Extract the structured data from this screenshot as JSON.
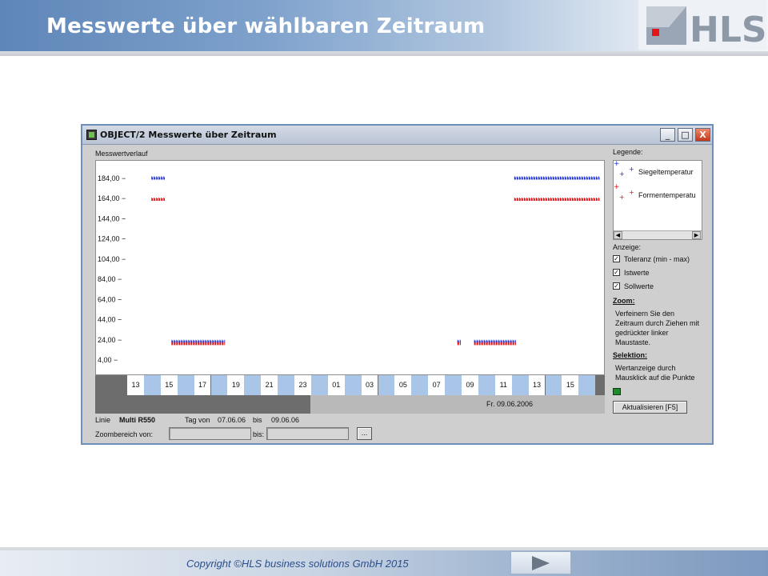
{
  "slide": {
    "title": "Messwerte über wählbaren Zeitraum",
    "logo_text": "HLS",
    "copyright": "Copyright ©HLS business solutions GmbH 2015"
  },
  "window": {
    "title": "OBJECT/2 Messwerte über Zeitraum",
    "buttons": [
      "_",
      "□",
      "X"
    ]
  },
  "plot": {
    "label": "Messwertverlauf",
    "y_ticks": [
      "184,00",
      "164,00",
      "144,00",
      "124,00",
      "104,00",
      "84,00",
      "64,00",
      "44,00",
      "24,00",
      "4,00"
    ],
    "timeline_ticks": [
      "13",
      "15",
      "17",
      "19",
      "21",
      "23",
      "01",
      "03",
      "05",
      "07",
      "09",
      "11",
      "13",
      "15"
    ],
    "date_label": "Fr. 09.06.2006"
  },
  "chart_data": {
    "type": "scatter",
    "x": [],
    "series": [
      {
        "name": "Siegeltemperatur",
        "color": "#1c2fd6",
        "segments": [
          {
            "x_start": 13.4,
            "x_end": 14.2,
            "y": 184
          },
          {
            "x_start": 14.6,
            "x_end": 17.8,
            "y": 22
          },
          {
            "x_start": 31.7,
            "x_end": 31.9,
            "y": 22
          },
          {
            "x_start": 32.7,
            "x_end": 35.2,
            "y": 22
          },
          {
            "x_start": 35.1,
            "x_end": 40.2,
            "y": 184
          }
        ]
      },
      {
        "name": "Formentemperatu",
        "color": "#e01515",
        "segments": [
          {
            "x_start": 13.4,
            "x_end": 14.2,
            "y": 163
          },
          {
            "x_start": 14.6,
            "x_end": 17.8,
            "y": 20
          },
          {
            "x_start": 31.7,
            "x_end": 31.9,
            "y": 20
          },
          {
            "x_start": 32.7,
            "x_end": 35.2,
            "y": 20
          },
          {
            "x_start": 35.1,
            "x_end": 40.2,
            "y": 163
          }
        ]
      }
    ],
    "ylim": [
      4,
      184
    ],
    "xlabel": "",
    "ylabel": "",
    "grid": false
  },
  "legend": {
    "title": "Legende:",
    "items": [
      "Siegeltemperatur",
      "Formentemperatu"
    ]
  },
  "anzeige": {
    "title": "Anzeige:",
    "options": [
      {
        "label": "Toleranz (min - max)",
        "checked": true
      },
      {
        "label": "Istwerte",
        "checked": true
      },
      {
        "label": "Sollwerte",
        "checked": true
      }
    ]
  },
  "zoom": {
    "title": "Zoom:",
    "text": [
      "Verfeinern Sie den",
      "Zeitraum durch Ziehen mit",
      "gedrückter linker",
      "Maustaste."
    ]
  },
  "selektion": {
    "title": "Selektion:",
    "text": [
      "Wertanzeige durch",
      "Mausklick auf die Punkte"
    ]
  },
  "refresh_button": "Aktualisieren [F5]",
  "info": {
    "linie_label": "Linie",
    "linie_value": "Multi R550",
    "tag_von_label": "Tag von",
    "tag_von_value": "07.06.06",
    "bis_label": "bis",
    "bis_value": "09.06.06",
    "zoombereich_label": "Zoombereich von:",
    "zoom_bis_label": "bis:",
    "zoom_von_value": "",
    "zoom_bis_value": "",
    "browse_label": "..."
  },
  "colors": {
    "accent": "#5e86b8",
    "series_blue": "#1c2fd6",
    "series_red": "#e01515",
    "timeline_blue": "#a9c6e8"
  }
}
